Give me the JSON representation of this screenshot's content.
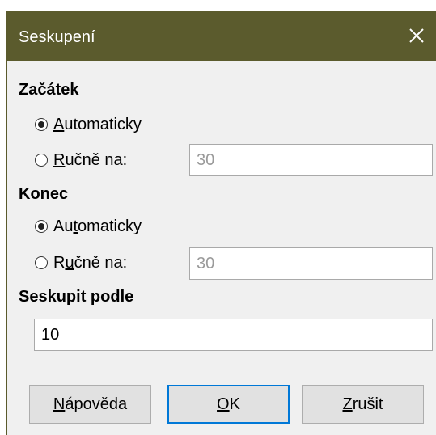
{
  "dialog": {
    "title": "Seskupení",
    "close_icon": "close-icon"
  },
  "start": {
    "heading": "Začátek",
    "auto_label": {
      "u": "A",
      "rest": "utomaticky"
    },
    "manual_label": {
      "u": "R",
      "rest": "učně na:"
    },
    "selected": "auto",
    "manual_value": "30"
  },
  "end": {
    "heading": "Konec",
    "auto_label": {
      "pre": "Au",
      "u": "t",
      "rest": "omaticky"
    },
    "manual_label": {
      "pre": "R",
      "u": "u",
      "rest": "čně na:"
    },
    "selected": "auto",
    "manual_value": "30"
  },
  "group_by": {
    "heading": "Seskupit podle",
    "value": "10"
  },
  "buttons": {
    "help": {
      "u": "N",
      "rest": "ápověda"
    },
    "ok": {
      "u": "O",
      "rest": "K"
    },
    "cancel": {
      "u": "Z",
      "rest": "rušit"
    }
  },
  "colors": {
    "titlebar": "#5b5b2d",
    "default_button_border": "#0078d7"
  }
}
